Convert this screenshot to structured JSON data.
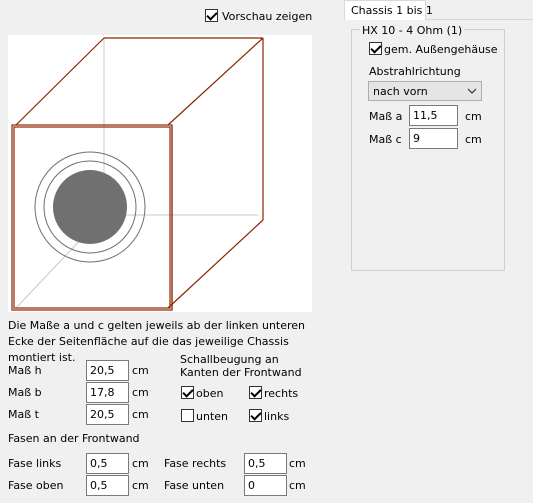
{
  "left": {
    "preview_checkbox": {
      "label": "Vorschau zeigen",
      "checked": true
    },
    "info_text": "Die Maße a und c gelten jeweils ab der linken unteren Ecke der Seitenfläche auf die das jeweilige Chassis montiert ist.",
    "dims": [
      {
        "label": "Maß h",
        "value": "20,5",
        "unit": "cm"
      },
      {
        "label": "Maß b",
        "value": "17,8",
        "unit": "cm"
      },
      {
        "label": "Maß t",
        "value": "20,5",
        "unit": "cm"
      }
    ],
    "diffraction": {
      "title": "Schallbeugung an Kanten der Frontwand",
      "oben": {
        "label": "oben",
        "checked": true
      },
      "rechts": {
        "label": "rechts",
        "checked": true
      },
      "unten": {
        "label": "unten",
        "checked": false
      },
      "links": {
        "label": "links",
        "checked": true
      }
    },
    "chamfer": {
      "title": "Fasen an der Frontwand",
      "fase_links": {
        "label": "Fase links",
        "value": "0,5",
        "unit": "cm"
      },
      "fase_rechts": {
        "label": "Fase rechts",
        "value": "0,5",
        "unit": "cm"
      },
      "fase_oben": {
        "label": "Fase oben",
        "value": "0,5",
        "unit": "cm"
      },
      "fase_unten": {
        "label": "Fase unten",
        "value": "0",
        "unit": "cm"
      }
    }
  },
  "right": {
    "tab_label": "Chassis 1 bis 1",
    "group_title": "HX 10 - 4 Ohm (1)",
    "housing_checkbox": {
      "label": "gem. Außengehäuse",
      "checked": true
    },
    "direction_label": "Abstrahlrichtung",
    "direction_value": "nach vorn",
    "mass_a": {
      "label": "Maß a",
      "value": "11,5",
      "unit": "cm"
    },
    "mass_c": {
      "label": "Maß c",
      "value": "9",
      "unit": "cm"
    }
  },
  "colors": {
    "box_edge": "#8b2500",
    "driver_fill": "#707070",
    "inner_line": "#c8c8c8"
  }
}
